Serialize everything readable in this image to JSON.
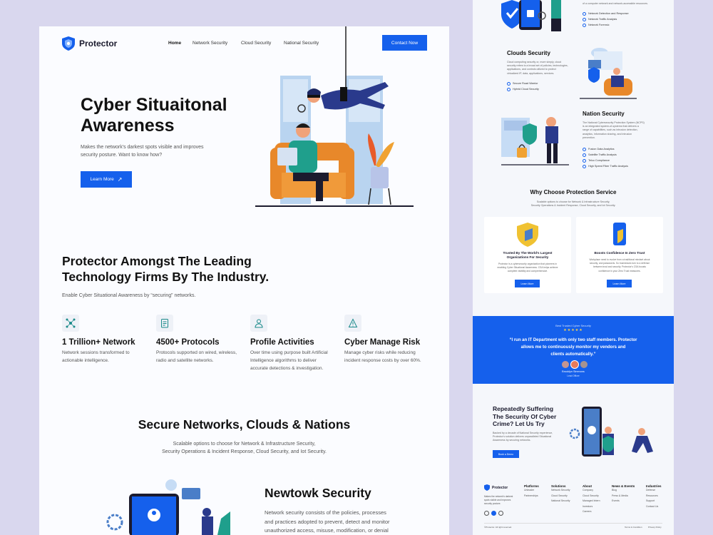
{
  "left": {
    "brand": "Protector",
    "nav": {
      "items": [
        "Home",
        "Network Security",
        "Cloud Security",
        "National Security"
      ],
      "contact": "Contact Now"
    },
    "hero": {
      "title_line1": "Cyber Situaitonal",
      "title_line2": "Awareness",
      "subtitle_line1": "Makes the network's darkest spots visible and improves",
      "subtitle_line2": "security posture. Want to know how?",
      "cta": "Learn More"
    },
    "leading": {
      "title_line1": "Protector Amongst The Leading",
      "title_line2": "Technology Firms By The Industry.",
      "subtitle": "Enable Cyber Situational Awareness by “securing” networks."
    },
    "stats": [
      {
        "title": "1 Trillion+ Network",
        "line1": "Network sessions transformed to",
        "line2": "actionable intelligence.",
        "line3": ""
      },
      {
        "title": "4500+ Protocols",
        "line1": "Protocols supported on wired, wireless,",
        "line2": "radio and satellite networks.",
        "line3": ""
      },
      {
        "title": "Profile Activities",
        "line1": "Over time using purpose built Artificial",
        "line2": "Intelligence algorithms to deliver",
        "line3": "accurate detections & investigation."
      },
      {
        "title": "Cyber Manage Risk",
        "line1": "Manage cyber risks while reducing",
        "line2": "incident response costs by over 60%.",
        "line3": ""
      }
    ],
    "secure": {
      "title": "Secure Networks, Clouds & Nations",
      "line1": "Scalable options to choose for Network & Infrastructure Security,",
      "line2": "Security Operations & Incident Response, Cloud Security, and Iot Security."
    },
    "newtowk": {
      "title": "Newtowk Security",
      "line1": "Network security consists of the policies, processes",
      "line2": "and practices adopted to prevent, detect and monitor",
      "line3": "unauthorized access, misuse, modification, or denial"
    }
  },
  "right": {
    "network_list": [
      "Network Detection and Response",
      "Network Traffic Analysis",
      "Network Forensic"
    ],
    "network_top_text": "of a computer network and network-accessible resources.",
    "clouds": {
      "title": "Clouds Security",
      "p1": "Cloud computing security or, more simply, cloud",
      "p2": "security refers to a broad set of policies, technologies,",
      "p3": "applications, and controls utilized to protect",
      "p4": "virtualized IP, data, applications, services.",
      "items": [
        "Secure Road Warrior",
        "Hybrid Cloud Security"
      ]
    },
    "nation": {
      "title": "Nation Security",
      "p1": "The National Cybersecurity Protection System (NCPS)",
      "p2": "is an integrated system-of-systems that delivers a",
      "p3": "range of capabilities, such as intrusion detection,",
      "p4": "analytics, information sharing, and intrusion",
      "p5": "prevention.",
      "items": [
        "Fusion Data Analytics",
        "Satellite Traffic Analysis",
        "Telco Compliance",
        "High Speed Fiber Traffic Analysis"
      ]
    },
    "why": {
      "title": "Why Choose Protection Service",
      "line1": "Scalable options to choose for Network & Infrastructure Security,",
      "line2": "Security Operations & Incident Response, Cloud Security, and Iot Security.",
      "cards": [
        {
          "title1": "Trusted By The World's Largest",
          "title2": "Organizations For Security",
          "p1": "Protector is a cybersecurity organization that pioneers in",
          "p2": "enabling Cyber Situational Awareness. CSA helps achieve",
          "p3": "complete visibility and comprehensive.",
          "cta": "Learn More"
        },
        {
          "title1": "Boosts Confidence In Zero Trust",
          "title2": "",
          "p1": "Workplace need to evolve from a traditional mindset about",
          "p2": "security, and passwords. So businesses turn to a defense",
          "p3": "between trust and security. Protector's CSA boosts",
          "p4": "confidence in your Zero Trust measures.",
          "cta": "Learn More"
        }
      ]
    },
    "testimonial": {
      "label": "Best Trusted Cyber Security",
      "stars": "★★★★★",
      "quote1": "“I run an IT Department with only two staff members. Protector",
      "quote2": "allows me to continuously monitor my vendors and",
      "quote3": "clients automatically.”",
      "name": "Brooklyn Simmons",
      "role": "Lead Officer"
    },
    "cta": {
      "title1": "Repeatedly Suffering",
      "title2": "The Security Of Cyber",
      "title3": "Crime? Let Us Try",
      "p1": "Backed by a decade of National Security experience,",
      "p2": "Protector's solution delivers unparalleled Situational",
      "p3": "Awareness by securing networks.",
      "button": "Book a Demo"
    },
    "footer": {
      "brand": "Protector",
      "about1": "Makes the network's darkest",
      "about2": "spots visible and improves",
      "about3": "security posture.",
      "cols": [
        {
          "title": "Platforms",
          "items": [
            "Unleader",
            "Partnerships"
          ]
        },
        {
          "title": "Solutions",
          "items": [
            "Network Security",
            "Cloud Security",
            "National Security"
          ]
        },
        {
          "title": "About",
          "items": [
            "Company",
            "Cloud Security",
            "Managed Intern",
            "Investors",
            "Careers"
          ]
        },
        {
          "title": "News & Events",
          "items": [
            "Blog",
            "Press & Media",
            "Events"
          ]
        },
        {
          "title": "Industries",
          "items": [
            "Defense",
            "Resources",
            "Support",
            "Contact Us"
          ]
        }
      ],
      "copyright": "©Protector. All right reserved.",
      "terms": "Terms & Condition",
      "privacy": "Privacy Policy"
    }
  }
}
